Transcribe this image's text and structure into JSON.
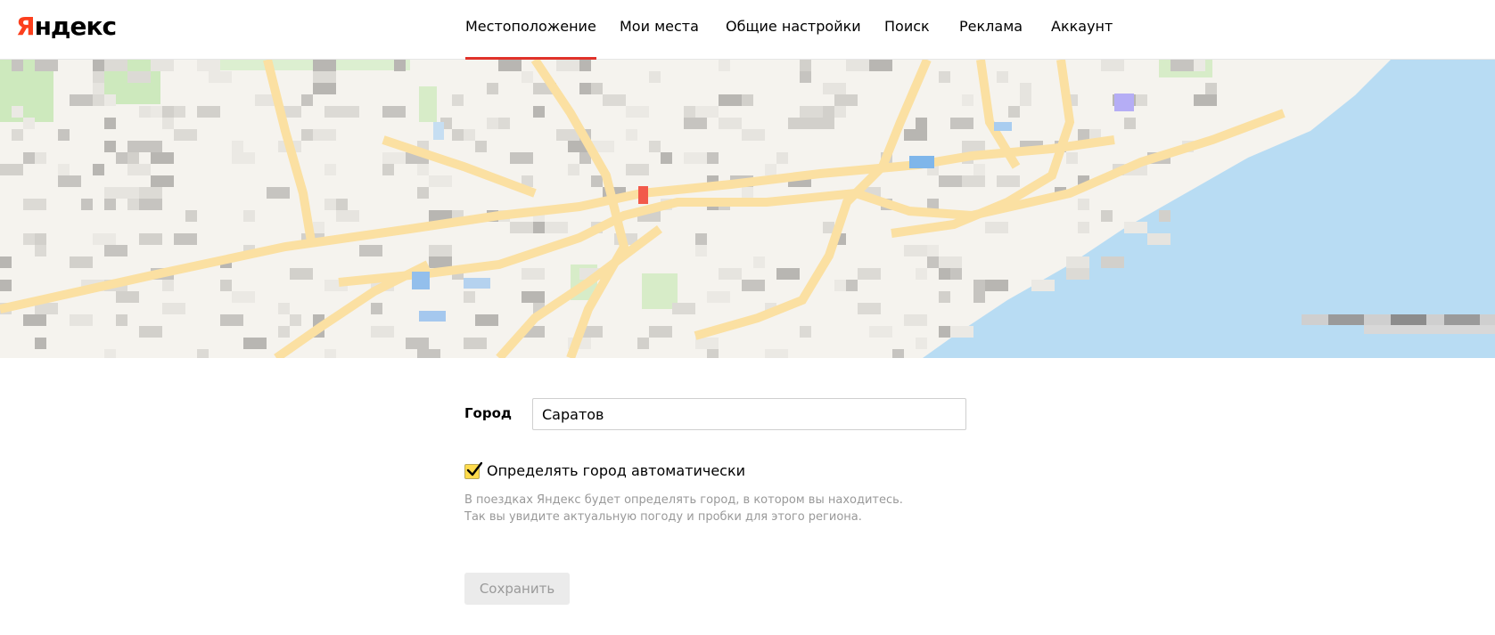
{
  "header": {
    "logo_first": "Я",
    "logo_rest": "ндекс",
    "nav": [
      {
        "label": "Местоположение",
        "active": true
      },
      {
        "label": "Мои места",
        "active": false
      },
      {
        "label": "Общие настройки",
        "active": false
      },
      {
        "label": "Поиск",
        "active": false
      },
      {
        "label": "Реклама",
        "active": false
      },
      {
        "label": "Аккаунт",
        "active": false
      }
    ]
  },
  "colors": {
    "brand_red": "#fc3f1d",
    "active_tab_underline": "#e0322a",
    "checkbox_fill": "#ffdb4d",
    "map_land": "#f5f3ee",
    "map_water": "#b8dcf3",
    "map_road": "#fbe0a2",
    "map_park": "#cde9bd",
    "map_marker": "#f25a4b"
  },
  "form": {
    "city_label": "Город",
    "city_value": "Саратов",
    "auto_detect_label": "Определять город автоматически",
    "auto_detect_checked": true,
    "hint_line1": "В поездках Яндекс будет определять город, в котором вы находитесь.",
    "hint_line2": "Так вы увидите актуальную погоду и пробки для этого региона.",
    "save_label": "Сохранить"
  }
}
